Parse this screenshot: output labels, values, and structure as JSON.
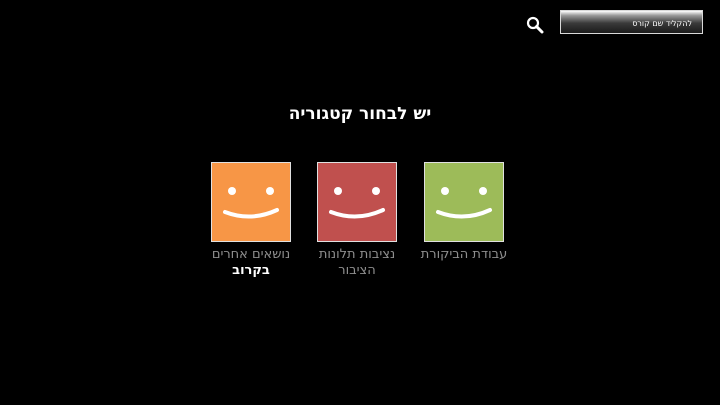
{
  "search": {
    "placeholder": "להקליד שם קורס",
    "icon": "search-icon"
  },
  "page": {
    "title": "יש לבחור קטגוריה"
  },
  "categories": [
    {
      "label": "עבודת הביקורת",
      "sub_label": "",
      "color": "#9dbb59",
      "icon": "smiley-icon"
    },
    {
      "label": "נציבות תלונות הציבור",
      "sub_label": "",
      "color": "#c0504e",
      "icon": "smiley-icon"
    },
    {
      "label": "נושאים אחרים",
      "sub_label": "בקרוב",
      "color": "#f79646",
      "icon": "smiley-icon"
    }
  ],
  "colors": {
    "background": "#000000",
    "label_text": "#8e8e8e",
    "highlight_text": "#ffffff"
  }
}
